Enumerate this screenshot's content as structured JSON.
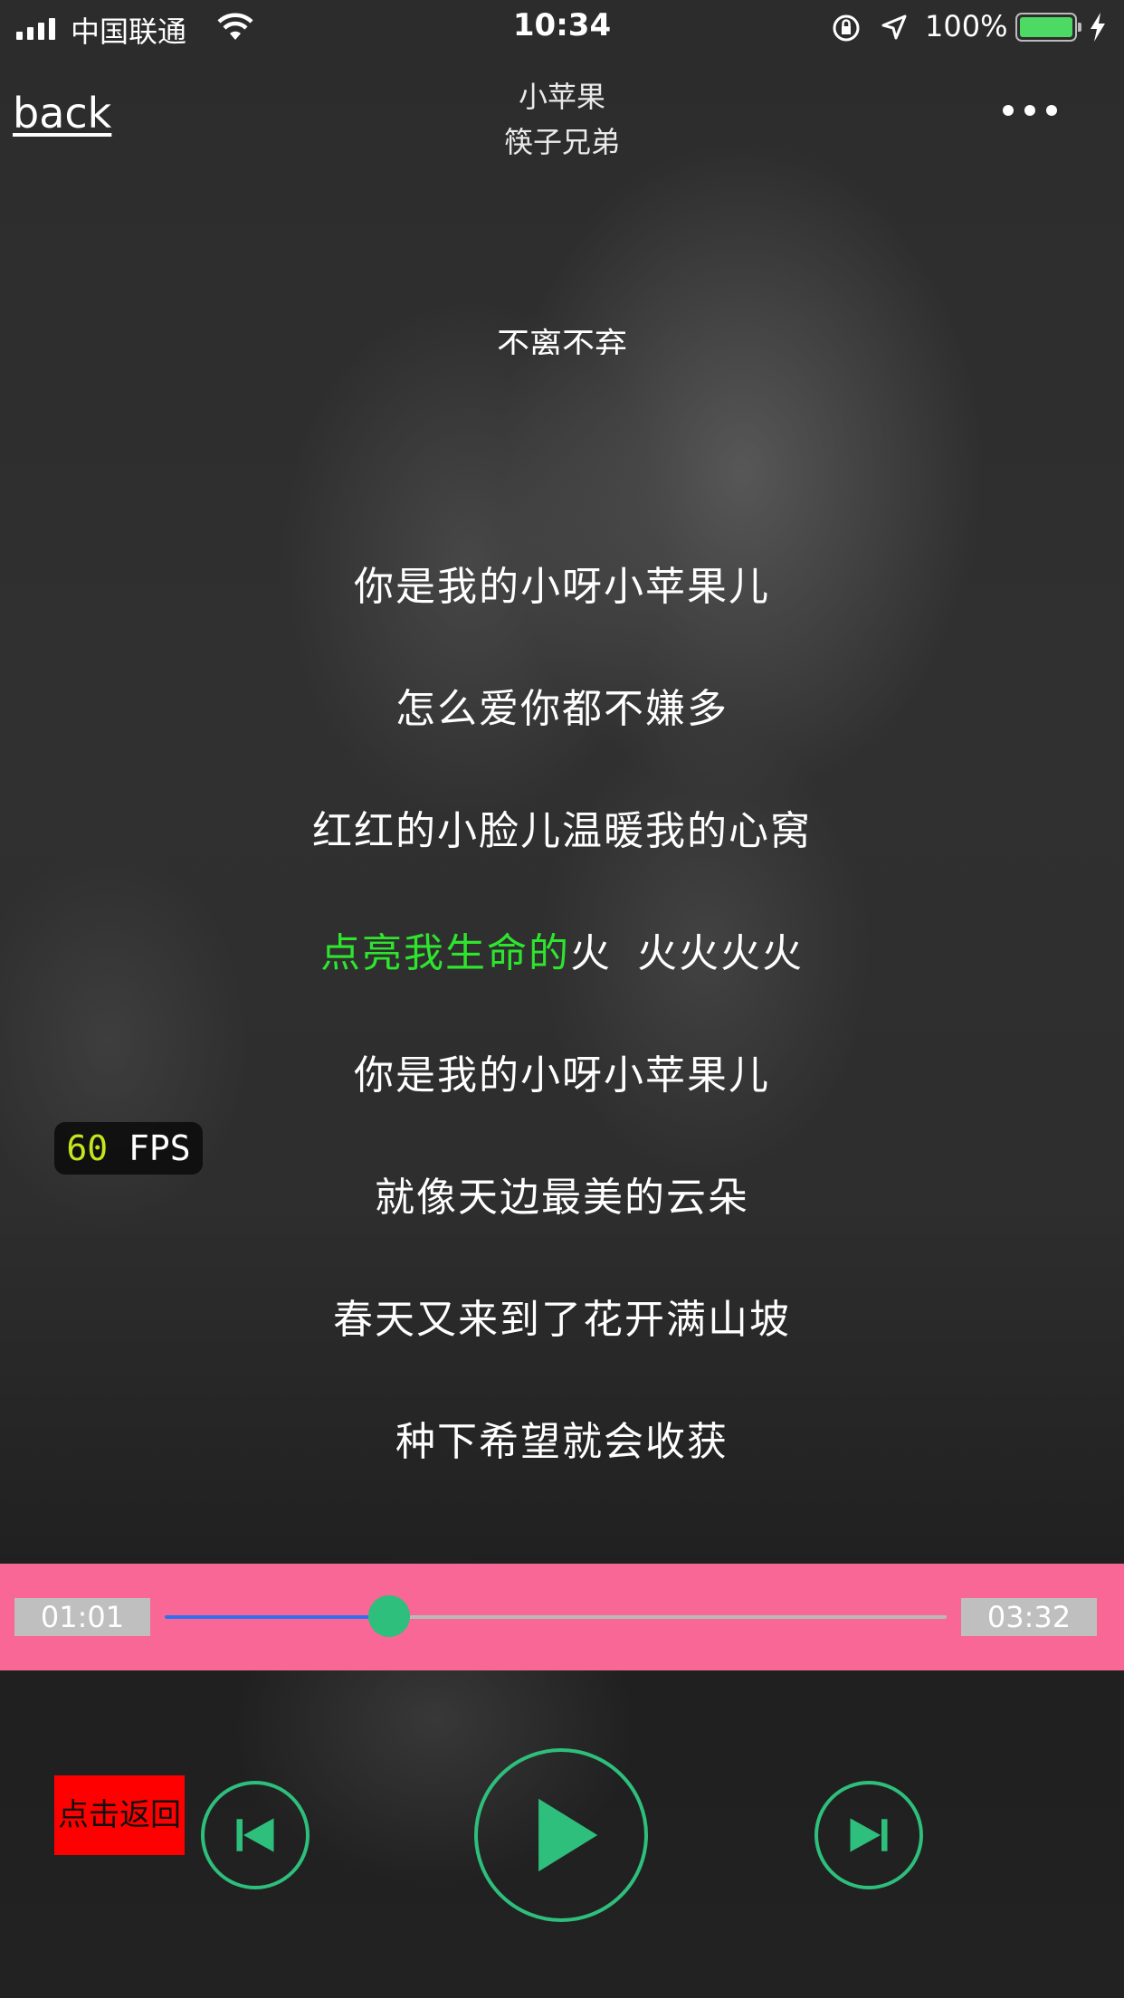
{
  "status_bar": {
    "carrier": "中国联通",
    "time": "10:34",
    "battery_percent": "100%",
    "battery_level": 1.0,
    "signal_bars": 4
  },
  "nav": {
    "back_label": "back",
    "song_title": "小苹果",
    "artist": "筷子兄弟",
    "more_icon": "more-dots-icon"
  },
  "lyrics": {
    "faded_line": "不离不弃",
    "lines": [
      "你是我的小呀小苹果儿",
      "怎么爱你都不嫌多",
      "红红的小脸儿温暖我的心窝",
      "",
      "你是我的小呀小苹果儿",
      "就像天边最美的云朵",
      "春天又来到了花开满山坡",
      "种下希望就会收获"
    ],
    "current_line": {
      "sung": "点亮我生命的",
      "unsung_a": "火",
      "unsung_b": "火火火火"
    },
    "highlight_color": "#2ee52e"
  },
  "fps": {
    "value": "60",
    "unit": "FPS"
  },
  "progress": {
    "current_time": "01:01",
    "total_time": "03:32",
    "fraction": 0.287,
    "bar_color": "#f86796",
    "fill_color": "#2f6ff0",
    "thumb_color": "#2dbf7b"
  },
  "controls": {
    "back_button_label": "点击返回",
    "accent_color": "#2dbf7b",
    "prev_icon": "skip-previous-icon",
    "play_icon": "play-icon",
    "next_icon": "skip-next-icon"
  }
}
